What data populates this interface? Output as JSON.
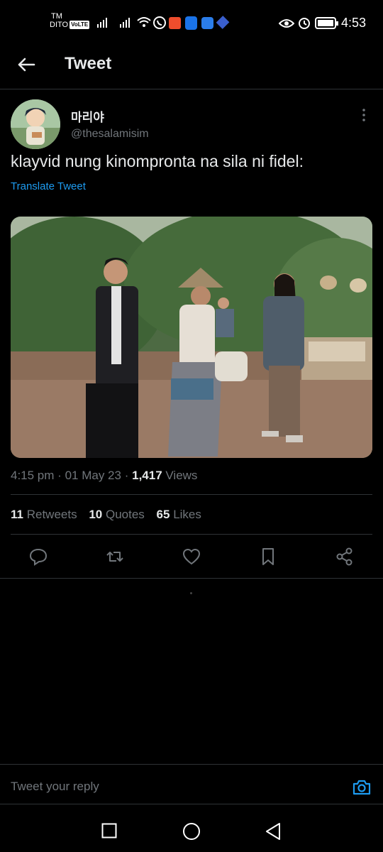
{
  "status_bar": {
    "carrier_top": "TM",
    "carrier_bottom": "DITO",
    "volte": "VoLTE",
    "time": "4:53"
  },
  "header": {
    "title": "Tweet"
  },
  "tweet": {
    "display_name": "마리야",
    "handle": "@thesalamisim",
    "text": "klayvid nung kinompronta na sila ni fidel:",
    "translate_label": "Translate Tweet",
    "time": "4:15 pm",
    "date": "01 May 23",
    "views_count": "1,417",
    "views_label": "Views",
    "separator": "·",
    "retweets_count": "11",
    "retweets_label": "Retweets",
    "quotes_count": "10",
    "quotes_label": "Quotes",
    "likes_count": "65",
    "likes_label": "Likes"
  },
  "reply": {
    "placeholder": "Tweet your reply"
  },
  "colors": {
    "accent": "#1d9bf0",
    "background": "#000000",
    "secondary_text": "#71767b"
  },
  "icons": [
    "back-arrow-icon",
    "more-vertical-icon",
    "reply-icon",
    "retweet-icon",
    "like-icon",
    "bookmark-icon",
    "share-icon",
    "camera-icon",
    "nav-recents-icon",
    "nav-home-icon",
    "nav-back-icon"
  ]
}
